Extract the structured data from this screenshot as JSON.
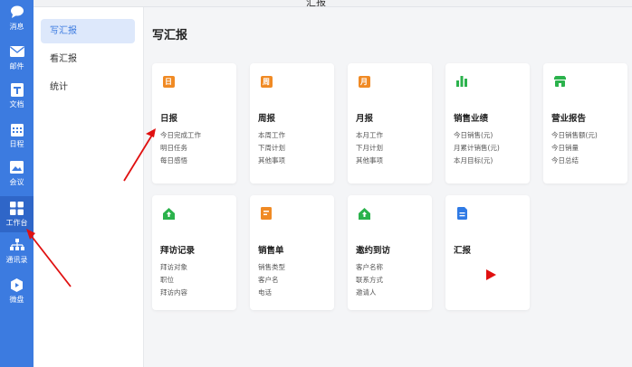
{
  "window": {
    "title": "汇报"
  },
  "rail": {
    "items": [
      {
        "label": "消息",
        "icon": "chat-icon"
      },
      {
        "label": "邮件",
        "icon": "mail-icon"
      },
      {
        "label": "文档",
        "icon": "document-icon"
      },
      {
        "label": "日程",
        "icon": "calendar-icon"
      },
      {
        "label": "会议",
        "icon": "meeting-icon"
      },
      {
        "label": "工作台",
        "icon": "grid-icon",
        "active": true
      },
      {
        "label": "通讯录",
        "icon": "org-chart-icon"
      },
      {
        "label": "微盘",
        "icon": "drive-icon"
      }
    ]
  },
  "subnav": {
    "items": [
      {
        "label": "写汇报",
        "active": true
      },
      {
        "label": "看汇报"
      },
      {
        "label": "统计"
      }
    ]
  },
  "main": {
    "title": "写汇报",
    "cards": [
      {
        "title": "日报",
        "icon_text": "日",
        "icon": "daily-tag-icon",
        "lines": [
          "今日完成工作",
          "明日任务",
          "每日感悟"
        ]
      },
      {
        "title": "周报",
        "icon_text": "周",
        "icon": "weekly-tag-icon",
        "lines": [
          "本周工作",
          "下周计划",
          "其他事项"
        ]
      },
      {
        "title": "月报",
        "icon_text": "月",
        "icon": "monthly-tag-icon",
        "lines": [
          "本月工作",
          "下月计划",
          "其他事项"
        ]
      },
      {
        "title": "销售业绩",
        "icon": "bar-chart-icon",
        "lines": [
          "今日销售(元)",
          "月累计销售(元)",
          "本月目标(元)"
        ]
      },
      {
        "title": "营业报告",
        "icon": "store-icon",
        "lines": [
          "今日销售额(元)",
          "今日销量",
          "今日总结"
        ]
      },
      {
        "title": "拜访记录",
        "icon": "house-visit-icon",
        "lines": [
          "拜访对象",
          "职位",
          "拜访内容"
        ]
      },
      {
        "title": "销售单",
        "icon": "sales-form-icon",
        "lines": [
          "销售类型",
          "客户名",
          "电话"
        ]
      },
      {
        "title": "邀约到访",
        "icon": "house-invite-icon",
        "lines": [
          "客户名称",
          "联系方式",
          "邀请人"
        ]
      },
      {
        "title": "汇报",
        "icon": "report-doc-icon",
        "lines": []
      }
    ]
  },
  "colors": {
    "rail": "#3c7be0",
    "rail_active": "#2f66c8",
    "accent": "#3c7be0",
    "orange": "#f08a24",
    "green": "#2bb24c",
    "annotation_red": "#e01010"
  }
}
